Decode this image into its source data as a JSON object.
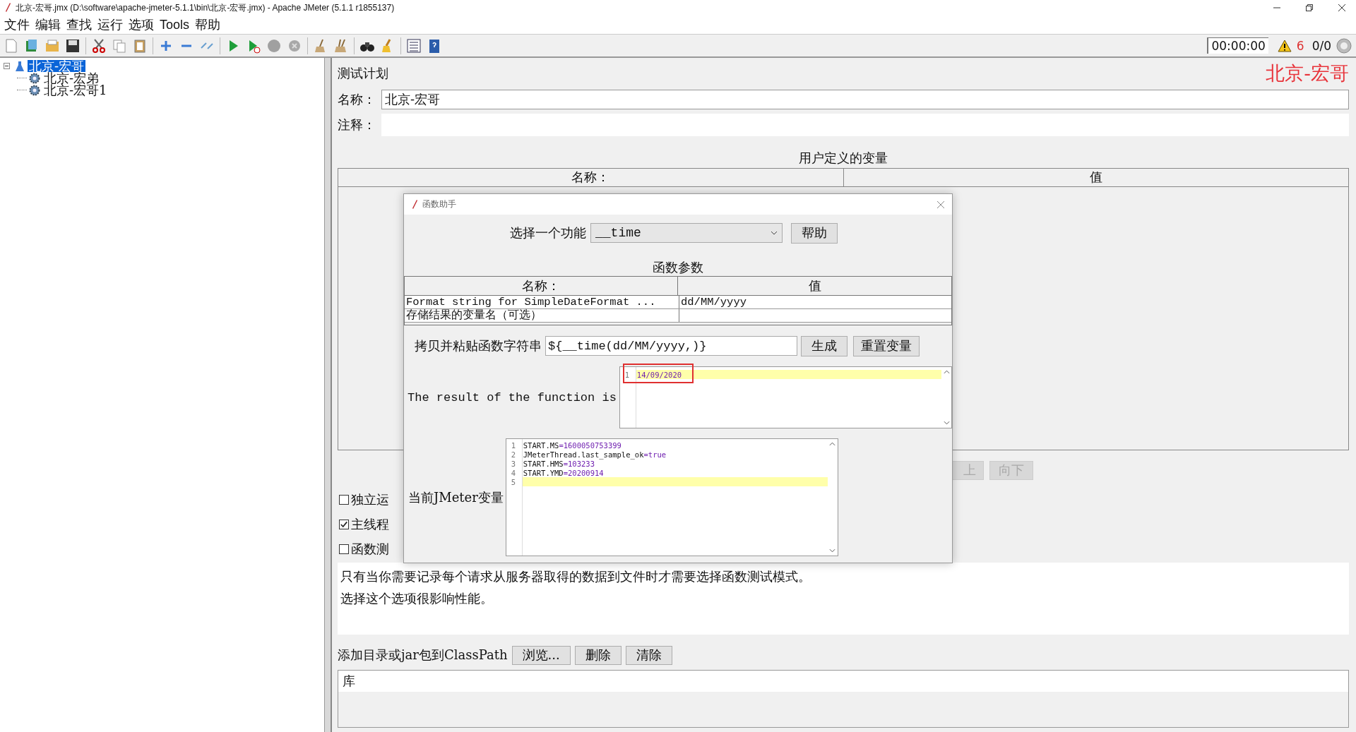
{
  "window": {
    "title": "北京-宏哥.jmx (D:\\software\\apache-jmeter-5.1.1\\bin\\北京-宏哥.jmx) - Apache JMeter (5.1.1 r1855137)"
  },
  "menu": [
    "文件",
    "编辑",
    "查找",
    "运行",
    "选项",
    "Tools",
    "帮助"
  ],
  "toolbar_status": {
    "timer": "00:00:00",
    "warnings": "6",
    "threads": "0/0"
  },
  "tree": [
    {
      "label": "北京-宏哥",
      "selected": true,
      "expanded": true,
      "children": [
        {
          "label": "北京-宏弟",
          "selected": false
        },
        {
          "label": "北京-宏哥1",
          "selected": false
        }
      ]
    }
  ],
  "panel": {
    "title": "测试计划",
    "badge": "北京-宏哥",
    "name_label": "名称：",
    "name_value": "北京-宏哥",
    "comment_label": "注释：",
    "variables_title": "用户定义的变量",
    "variables_columns": [
      "名称：",
      "值"
    ],
    "buttons": [
      {
        "label": "上",
        "disabled": true
      },
      {
        "label": "向下",
        "disabled": true
      }
    ],
    "options": [
      {
        "label": "独立运",
        "checked": false
      },
      {
        "label": "主线程",
        "checked": true
      },
      {
        "label": "函数测",
        "checked": false
      }
    ],
    "description": [
      "只有当你需要记录每个请求从服务器取得的数据到文件时才需要选择函数测试模式。",
      "选择这个选项很影响性能。"
    ],
    "classpath_label": "添加目录或jar包到ClassPath",
    "classpath_buttons": [
      "浏览...",
      "删除",
      "清除"
    ],
    "library_column": "库"
  },
  "dialog": {
    "title": "函数助手",
    "function_label": "选择一个功能",
    "function_value": "__time",
    "help_button": "帮助",
    "params_title": "函数参数",
    "params_columns": [
      "名称：",
      "值"
    ],
    "params_rows": [
      {
        "name": "Format string for SimpleDateFormat ...",
        "value": "dd/MM/yyyy"
      },
      {
        "name": "存储结果的变量名（可选）"
      }
    ],
    "copy_label": "拷贝并粘贴函数字符串",
    "copy_value": "${__time(dd/MM/yyyy,)}",
    "generate_button": "生成",
    "reset_button": "重置变量",
    "result_label": "The result of the function is",
    "result_lines": [
      {
        "number": "1",
        "text": "14/09/2020",
        "current": true,
        "marked": true
      }
    ],
    "variables_label": "当前JMeter变量",
    "variables_lines": [
      {
        "number": "1",
        "key": "START.MS",
        "value": "=1600050753399",
        "current": false
      },
      {
        "number": "2",
        "key": "JMeterThread.last_sample_ok",
        "value": "=true",
        "current": false
      },
      {
        "number": "3",
        "key": "START.HMS",
        "value": "=103233",
        "current": false
      },
      {
        "number": "4",
        "key": "START.YMD",
        "value": "=20200914",
        "current": false
      },
      {
        "number": "5",
        "current": true
      }
    ]
  }
}
